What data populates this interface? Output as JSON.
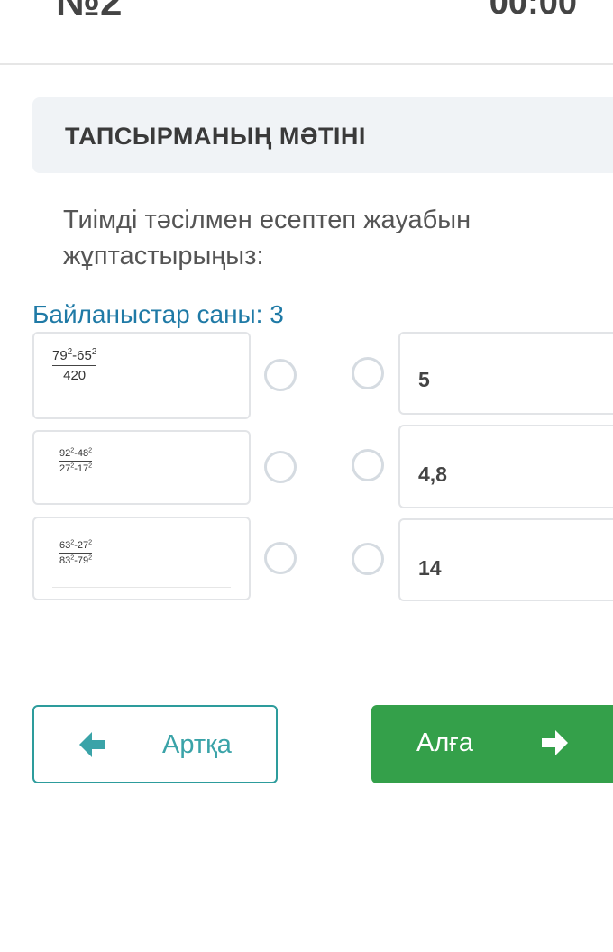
{
  "header": {
    "question_number": "№2",
    "timer": "00:00"
  },
  "task": {
    "title": "ТАПСЫРМАНЫҢ МӘТІНІ",
    "instruction": "Тиімді тәсілмен есептеп жауабын жұптастырыңыз:",
    "links_count": "Байланыстар саны: 3"
  },
  "left_items": [
    {
      "num_a": "79",
      "num_b": "65",
      "exp": "2",
      "den": "420"
    },
    {
      "num_a": "92",
      "num_b": "48",
      "den_a": "27",
      "den_b": "17",
      "exp": "2"
    },
    {
      "num_a": "63",
      "num_b": "27",
      "den_a": "83",
      "den_b": "79",
      "exp": "2"
    }
  ],
  "right_items": [
    {
      "value": "5"
    },
    {
      "value": "4,8"
    },
    {
      "value": "14"
    }
  ],
  "nav": {
    "back_label": "Артқа",
    "next_label": "Алға"
  },
  "colors": {
    "accent_teal": "#2d9c9c",
    "next_green": "#34a04a",
    "links_blue": "#1f7aa6"
  },
  "icons": {
    "back": "arrow-left-icon",
    "next": "arrow-right-icon"
  }
}
